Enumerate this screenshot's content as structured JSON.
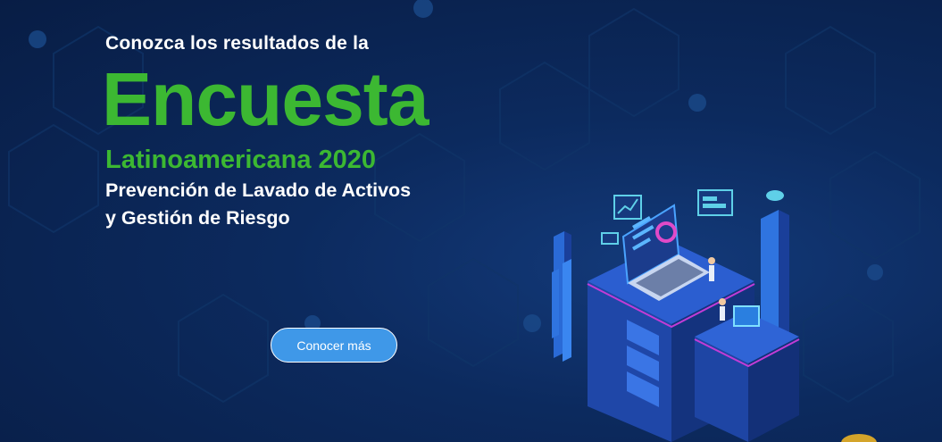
{
  "hero": {
    "intro": "Conozca los resultados de la",
    "headline": "Encuesta",
    "subheadline": "Latinoamericana 2020",
    "topic_line1": "Prevención de Lavado de Activos",
    "topic_line2": "y Gestión de Riesgo",
    "cta_label": "Conocer más"
  },
  "colors": {
    "background": "#0c2a5e",
    "accent_green": "#3cb832",
    "button_blue": "#3f98e8",
    "text_white": "#ffffff"
  },
  "icons": {
    "illustration": "isometric-data-center-illustration"
  }
}
